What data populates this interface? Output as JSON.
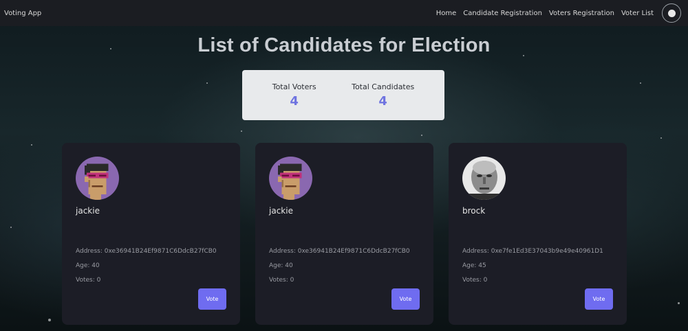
{
  "navbar": {
    "brand": "Voting App",
    "links": [
      "Home",
      "Candidate Registration",
      "Voters Registration",
      "Voter List"
    ]
  },
  "page_title": "List of Candidates for Election",
  "stats": {
    "total_voters_label": "Total Voters",
    "total_voters": "4",
    "total_candidates_label": "Total Candidates",
    "total_candidates": "4"
  },
  "candidates": [
    {
      "name": "jackie",
      "address": "Address: 0xe36941B24Ef9871C6DdcB27fCB0",
      "age": "Age: 40",
      "votes": "Votes: 0",
      "vote_label": "Vote",
      "avatar": "pixel-punk-avatar"
    },
    {
      "name": "jackie",
      "address": "Address: 0xe36941B24Ef9871C6DdcB27fCB0",
      "age": "Age: 40",
      "votes": "Votes: 0",
      "vote_label": "Vote",
      "avatar": "pixel-punk-avatar"
    },
    {
      "name": "brock",
      "address": "Address: 0xe7fe1Ed3E37043b9e49e40961D1",
      "age": "Age: 45",
      "votes": "Votes: 0",
      "vote_label": "Vote",
      "avatar": "grayscale-portrait-avatar"
    }
  ],
  "colors": {
    "accent": "#6f6cf0",
    "stat_value": "#6f74e0",
    "card_bg": "#1c1d26",
    "navbar_bg": "#1b1d22"
  }
}
